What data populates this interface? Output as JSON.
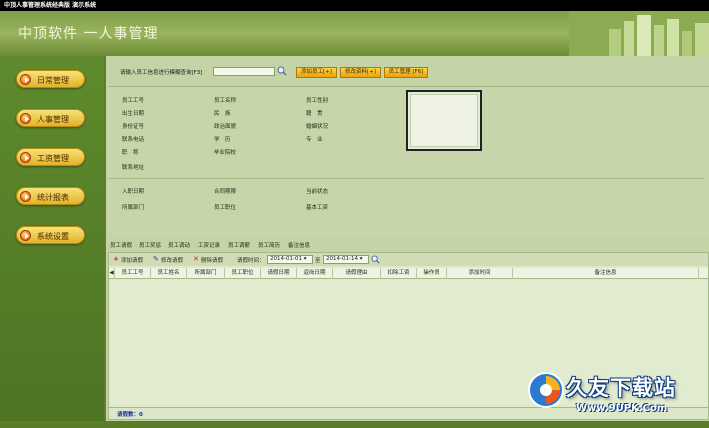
{
  "window": {
    "title": "中顶人事管理系统经典版 演示系统"
  },
  "banner": {
    "title": "中顶软件 一人事管理"
  },
  "sidebar": {
    "items": [
      {
        "label": "日常管理"
      },
      {
        "label": "人事管理"
      },
      {
        "label": "工资管理"
      },
      {
        "label": "统计报表"
      },
      {
        "label": "系统设置"
      }
    ]
  },
  "search": {
    "label": "请输入员工信息进行模糊查询[F3]",
    "value": ""
  },
  "toolbar": {
    "add": "添加员工[+]",
    "edit": "修改资料[+]",
    "manage": "员工管理 [F6]"
  },
  "fields": {
    "col1": [
      "员工工号",
      "出生日期",
      "身份证号",
      "联系电话",
      "职　称",
      "联系地址"
    ],
    "col2": [
      "员工名称",
      "民　族",
      "政治面貌",
      "学　历",
      "毕业院校"
    ],
    "col3": [
      "员工性别",
      "籍　贯",
      "婚姻状况",
      "专　业"
    ],
    "row2a": [
      "入职日期",
      "所属部门"
    ],
    "row2b": [
      "合同期限",
      "员工职位"
    ],
    "row2c": [
      "当前状态",
      "基本工资"
    ]
  },
  "tabs": [
    "员工请假",
    "员工奖惩",
    "员工调动",
    "工资记录",
    "员工调薪",
    "员工简历",
    "备注信息"
  ],
  "grid_toolbar": {
    "add": "添加请假",
    "edit": "修改请假",
    "delete": "删除请假",
    "time_label": "请假时间：",
    "date_from": "2014-01-01",
    "to": "至",
    "date_to": "2014-01-14"
  },
  "grid": {
    "columns": [
      "员工工号",
      "员工姓名",
      "所属部门",
      "员工职位",
      "请假日期",
      "返岗日期",
      "请假理由",
      "扣除工资",
      "操作员",
      "添加时间",
      "备注信息"
    ]
  },
  "footer": {
    "count": "请假数：0"
  },
  "watermark": {
    "text": "久友下载站",
    "url": "Www.9UPK.Com"
  },
  "colors": {
    "accent": "#e8a20e",
    "sidebar": "#5f8a2c",
    "panel": "#c4d4a6"
  }
}
